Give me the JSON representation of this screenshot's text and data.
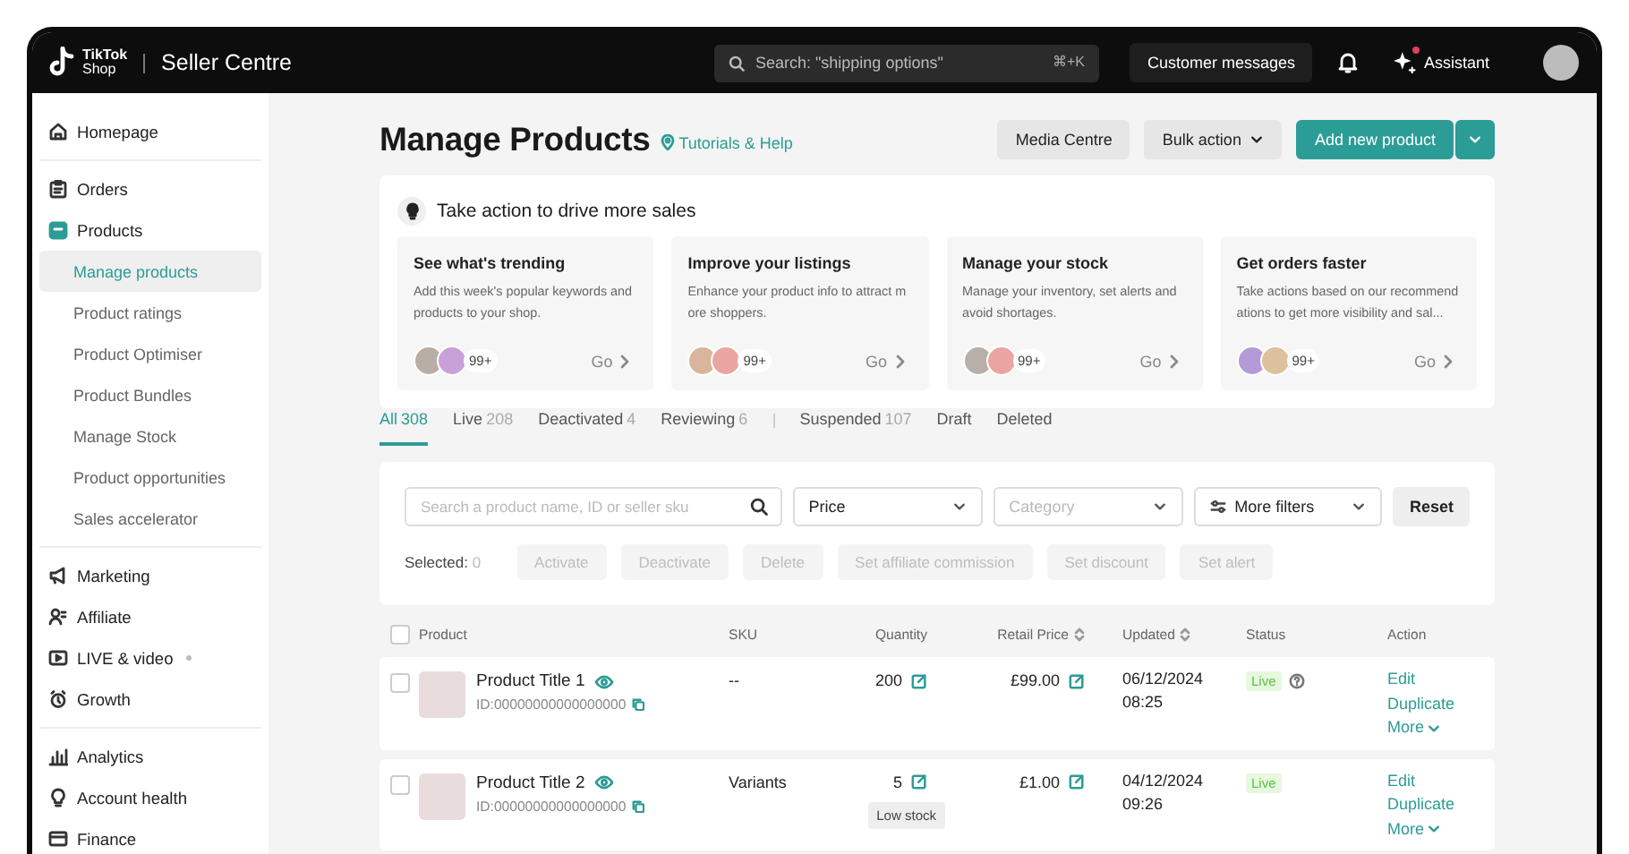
{
  "topbar": {
    "logo_line_1": "TikTok",
    "logo_line_2": "Shop",
    "product": "Seller Centre",
    "search": {
      "placeholder": "Search: \"shipping options\"",
      "shortcut": "⌘+K"
    },
    "messages_button": "Customer messages",
    "assistant": {
      "label": "Assistant",
      "notification": true
    }
  },
  "sidebar": {
    "groups": [
      {
        "items": [
          {
            "label": "Homepage",
            "kind": "home",
            "selected": false,
            "dot": false
          }
        ]
      },
      {
        "items": [
          {
            "label": "Orders",
            "kind": "clipboard",
            "selected": false,
            "dot": false
          },
          {
            "label": "Products",
            "kind": "box",
            "selected": false,
            "dot": false,
            "expanded": true,
            "children": [
              {
                "label": "Manage products",
                "selected": true
              },
              {
                "label": "Product ratings",
                "selected": false
              },
              {
                "label": "Product Optimiser",
                "selected": false
              },
              {
                "label": "Product Bundles",
                "selected": false
              },
              {
                "label": "Manage Stock",
                "selected": false
              },
              {
                "label": "Product opportunities",
                "selected": false
              },
              {
                "label": "Sales accelerator",
                "selected": false
              }
            ]
          }
        ]
      },
      {
        "items": [
          {
            "label": "Marketing",
            "kind": "megaphone",
            "selected": false,
            "dot": false
          },
          {
            "label": "Affiliate",
            "kind": "people",
            "selected": false,
            "dot": false
          },
          {
            "label": "LIVE & video",
            "kind": "video",
            "selected": false,
            "dot": true
          },
          {
            "label": "Growth",
            "kind": "stopwatch",
            "selected": false,
            "dot": false
          }
        ]
      },
      {
        "items": [
          {
            "label": "Analytics",
            "kind": "chart",
            "selected": false,
            "dot": false
          },
          {
            "label": "Account health",
            "kind": "bulb",
            "selected": false,
            "dot": false
          },
          {
            "label": "Finance",
            "kind": "card",
            "selected": false,
            "dot": false
          }
        ]
      }
    ]
  },
  "header": {
    "title": "Manage Products",
    "help_link": "Tutorials & Help",
    "buttons": [
      {
        "label": "Media Centre",
        "kind": "secondary"
      },
      {
        "label": "Bulk action",
        "kind": "dropdown"
      },
      {
        "label": "Add new product",
        "kind": "primary"
      }
    ]
  },
  "actions_panel": {
    "title": "Take action to drive more sales",
    "cards": [
      {
        "title": "See what's trending",
        "description": "Add this week's popular keywords and products to your shop.",
        "count": "99+",
        "link": "Go"
      },
      {
        "title": "Improve your listings",
        "description": "Enhance your product info to attract more shoppers.",
        "count": "99+",
        "link": "Go"
      },
      {
        "title": "Manage your stock",
        "description": "Manage your inventory, set alerts and avoid shortages.",
        "count": "99+",
        "link": "Go"
      },
      {
        "title": "Get orders faster",
        "description": "Take actions based on our recommendations to get more visibility and sal...",
        "count": "99+",
        "link": "Go"
      }
    ]
  },
  "status_tabs": [
    {
      "kind": "tab",
      "label": "All",
      "count": "308",
      "selected": true
    },
    {
      "kind": "tab",
      "label": "Live",
      "count": "208",
      "selected": false
    },
    {
      "kind": "tab",
      "label": "Deactivated",
      "count": "4",
      "selected": false
    },
    {
      "kind": "tab",
      "label": "Reviewing",
      "count": "6",
      "selected": false
    },
    {
      "kind": "separator"
    },
    {
      "kind": "tab",
      "label": "Suspended",
      "count": "107",
      "selected": false
    },
    {
      "kind": "tab",
      "label": "Draft",
      "selected": false
    },
    {
      "kind": "tab",
      "label": "Deleted",
      "selected": false
    }
  ],
  "filters": {
    "search": {
      "placeholder": "Search a product name, ID or seller sku"
    },
    "selects": [
      {
        "kind": "select",
        "value": "Price"
      },
      {
        "kind": "select",
        "placeholder": "Category"
      },
      {
        "kind": "filter",
        "value": "More filters"
      }
    ],
    "reset": "Reset",
    "selected_label": "Selected:",
    "selected_count": "0",
    "bulk_buttons": [
      {
        "label": "Activate",
        "disabled": true
      },
      {
        "label": "Deactivate",
        "disabled": true
      },
      {
        "label": "Delete",
        "disabled": true
      },
      {
        "label": "Set affiliate commission",
        "disabled": true
      },
      {
        "label": "Set discount",
        "disabled": true
      },
      {
        "label": "Set alert",
        "disabled": true
      }
    ]
  },
  "table": {
    "all_checked": false,
    "columns": [
      {
        "label": "Product",
        "sortable": false
      },
      {
        "label": "SKU",
        "sortable": false
      },
      {
        "label": "Quantity",
        "sortable": false
      },
      {
        "label": "Retail Price",
        "sortable": true
      },
      {
        "label": "Updated",
        "sortable": true
      },
      {
        "label": "Status",
        "sortable": false
      },
      {
        "label": "Action",
        "sortable": false
      }
    ],
    "rows": [
      {
        "checked": false,
        "title": "Product Title 1",
        "id": "ID:00000000000000000",
        "sku": "--",
        "quantity": "200",
        "price": "£99.00",
        "updated_date": "06/12/2024",
        "updated_time": "08:25",
        "status": {
          "label": "Live",
          "kind": "live"
        },
        "status_help": true,
        "actions": [
          {
            "label": "Edit",
            "kind": "link"
          },
          {
            "label": "Duplicate",
            "kind": "link"
          },
          {
            "label": "More",
            "kind": "menu"
          }
        ]
      },
      {
        "checked": false,
        "title": "Product Title 2",
        "id": "ID:00000000000000000",
        "sku": "Variants",
        "quantity": "5",
        "stock_badge": "Low stock",
        "price": "£1.00",
        "updated_date": "04/12/2024",
        "updated_time": "09:26",
        "status": {
          "label": "Live",
          "kind": "live"
        },
        "status_help": false,
        "actions": [
          {
            "label": "Edit",
            "kind": "link"
          },
          {
            "label": "Duplicate",
            "kind": "link"
          },
          {
            "label": "More",
            "kind": "menu"
          }
        ]
      }
    ]
  }
}
